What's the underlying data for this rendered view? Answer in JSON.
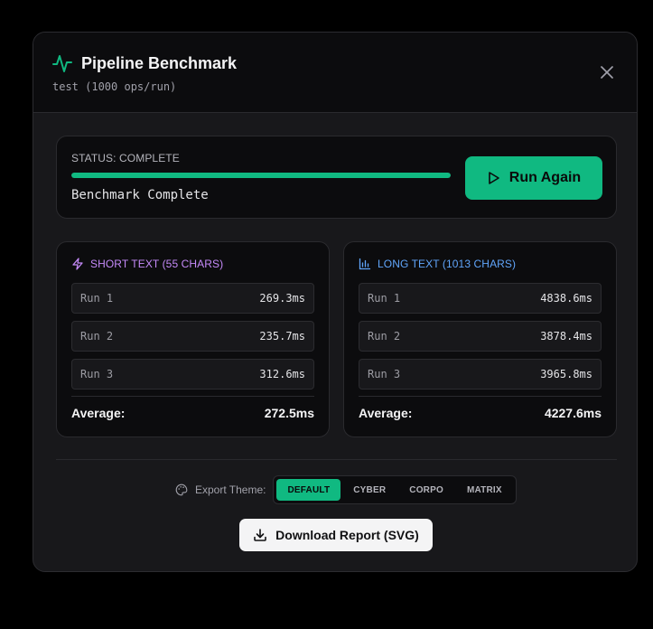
{
  "header": {
    "title": "Pipeline Benchmark",
    "subtitle": "test (1000 ops/run)",
    "icon": "activity-pulse-icon",
    "close_icon": "close-icon"
  },
  "status": {
    "label": "STATUS: COMPLETE",
    "progress_percent": 100,
    "message": "Benchmark Complete",
    "run_again_label": "Run Again",
    "run_again_icon": "play-icon"
  },
  "short_text": {
    "title": "SHORT TEXT (55 CHARS)",
    "icon": "lightning-icon",
    "runs": [
      {
        "label": "Run 1",
        "value": "269.3ms"
      },
      {
        "label": "Run 2",
        "value": "235.7ms"
      },
      {
        "label": "Run 3",
        "value": "312.6ms"
      }
    ],
    "average_label": "Average:",
    "average_value": "272.5ms"
  },
  "long_text": {
    "title": "LONG TEXT (1013 CHARS)",
    "icon": "bar-chart-icon",
    "runs": [
      {
        "label": "Run 1",
        "value": "4838.6ms"
      },
      {
        "label": "Run 2",
        "value": "3878.4ms"
      },
      {
        "label": "Run 3",
        "value": "3965.8ms"
      }
    ],
    "average_label": "Average:",
    "average_value": "4227.6ms"
  },
  "export": {
    "label": "Export Theme:",
    "icon": "palette-icon",
    "themes": [
      "DEFAULT",
      "CYBER",
      "CORPO",
      "MATRIX"
    ],
    "selected": "DEFAULT",
    "download_label": "Download Report (SVG)",
    "download_icon": "download-icon"
  },
  "colors": {
    "accent": "#10b981",
    "short_accent": "#c58af9",
    "long_accent": "#60a5fa",
    "background": "#000000",
    "panel": "#18181b",
    "card": "#0c0c0e"
  }
}
